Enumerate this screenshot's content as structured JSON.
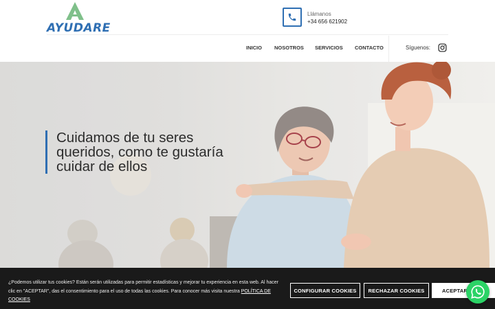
{
  "brand": {
    "name": "AYUDARE",
    "color": "#2f6fb3",
    "accent": "#7fc08a"
  },
  "contact": {
    "label": "Llámanos",
    "phone": "+34 656 621902",
    "icon": "phone-icon"
  },
  "nav": {
    "items": [
      {
        "label": "INICIO"
      },
      {
        "label": "NOSOTROS"
      },
      {
        "label": "SERVICIOS"
      },
      {
        "label": "CONTACTO"
      }
    ],
    "follow_label": "Síguenos:",
    "social_icon": "instagram-icon"
  },
  "hero": {
    "heading": "Cuidamos de tu seres queridos, como te gustaría cuidar de ellos"
  },
  "cookies": {
    "text": "¿Podemos utilizar tus cookies? Están serán utilizadas para permitir estadísticas y mejorar tu experiencia en esta web. Al hacer clic en \"ACEPTAR\", das el consentimiento para el uso de todas las cookies. Para conocer más visita nuestra",
    "policy_link": "POLÍTICA DE COOKIES",
    "configure_label": "CONFIGURAR COOKIES",
    "reject_label": "RECHAZAR COOKIES",
    "accept_label": "ACEPTAR T",
    "background": "#1a1a1a"
  },
  "whatsapp": {
    "icon": "whatsapp-icon",
    "color": "#2bd366"
  }
}
